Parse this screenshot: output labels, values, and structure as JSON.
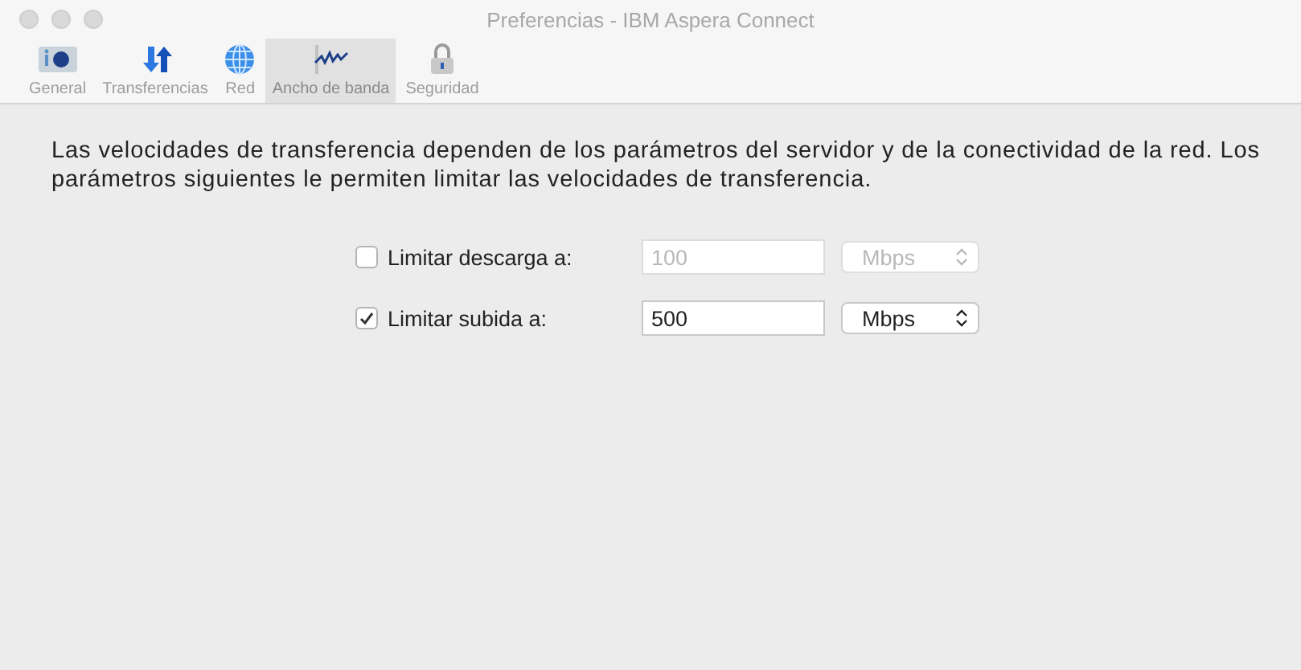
{
  "window": {
    "title": "Preferencias - IBM Aspera Connect"
  },
  "tabs": [
    {
      "label": "General",
      "selected": false
    },
    {
      "label": "Transferencias",
      "selected": false
    },
    {
      "label": "Red",
      "selected": false
    },
    {
      "label": "Ancho de banda",
      "selected": true
    },
    {
      "label": "Seguridad",
      "selected": false
    }
  ],
  "description": "Las velocidades de transferencia dependen de los parámetros del servidor y de la conectividad de la red.  Los parámetros siguientes le permiten limitar las velocidades de transferencia.",
  "limits": [
    {
      "label": "Limitar descarga a:",
      "checked": false,
      "value": "100",
      "unit": "Mbps"
    },
    {
      "label": "Limitar subida a:",
      "checked": true,
      "value": "500",
      "unit": "Mbps"
    }
  ]
}
